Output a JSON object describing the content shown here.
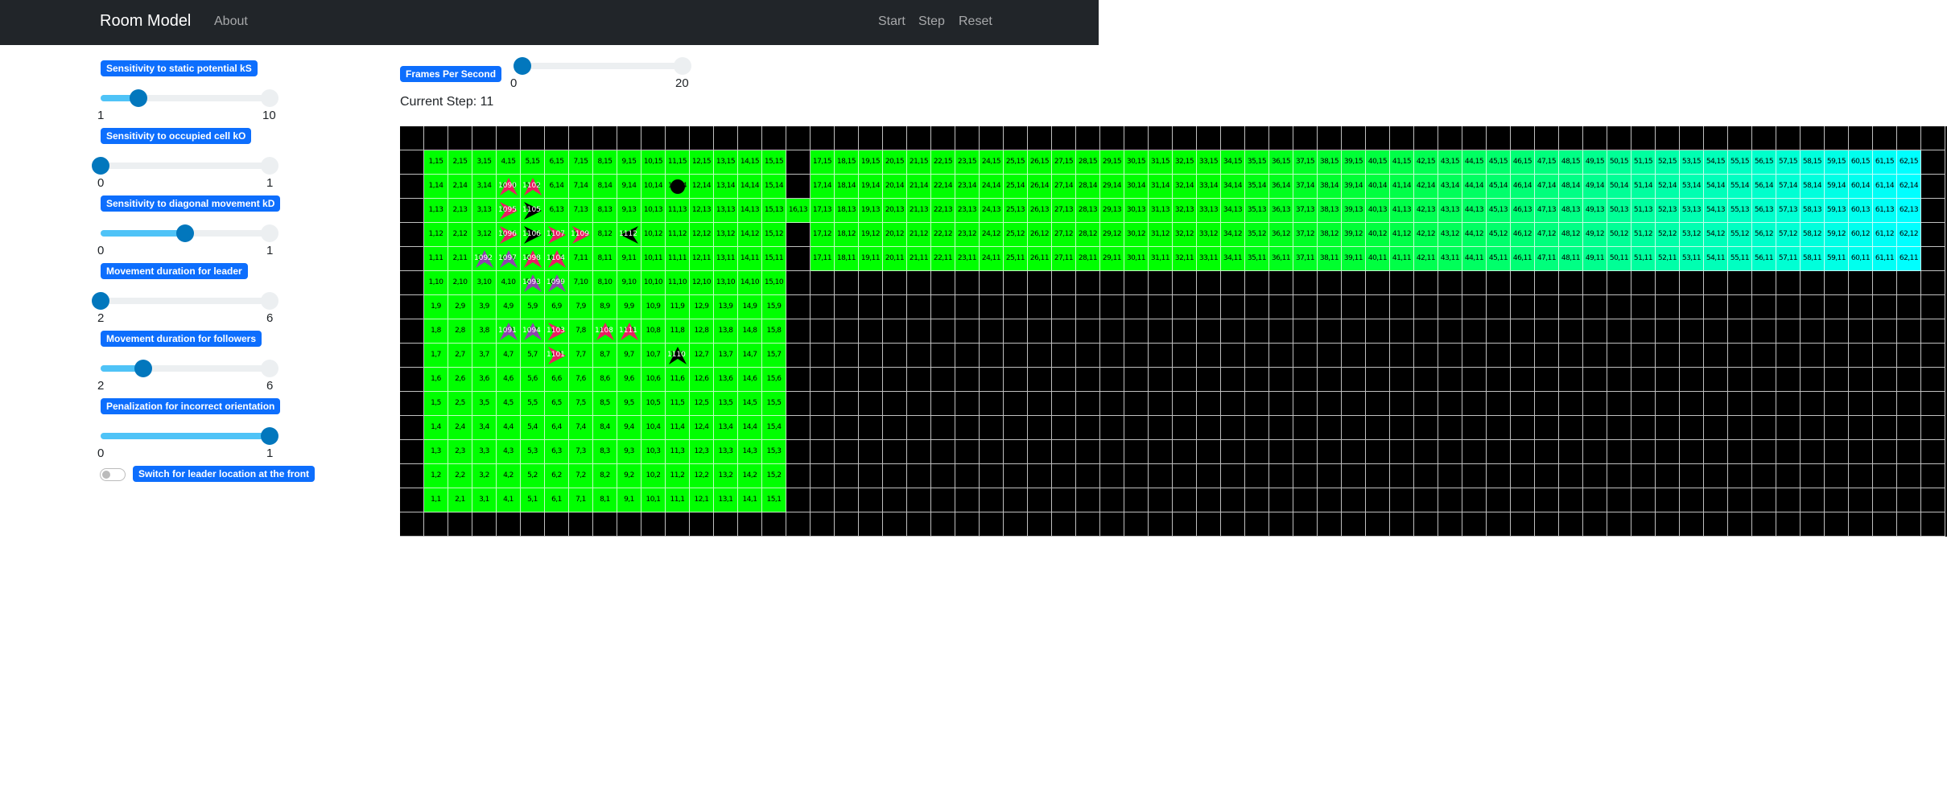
{
  "navbar": {
    "brand": "Room Model",
    "links": {
      "about": "About",
      "start": "Start",
      "step": "Step",
      "reset": "Reset"
    },
    "background": "#212529"
  },
  "controls": {
    "ks": {
      "label": "Sensitivity to static potential kS",
      "min_label": "1",
      "max_label": "10",
      "min": 1,
      "max": 10,
      "value": 3
    },
    "ko": {
      "label": "Sensitivity to occupied cell kO",
      "min_label": "0",
      "max_label": "1",
      "min": 0,
      "max": 1,
      "value": 0
    },
    "kd": {
      "label": "Sensitivity to diagonal movement kD",
      "min_label": "0",
      "max_label": "1",
      "min": 0,
      "max": 1,
      "value": 0.5
    },
    "leader_duration": {
      "label": "Movement duration for leader",
      "min_label": "2",
      "max_label": "6",
      "min": 2,
      "max": 6,
      "value": 2
    },
    "follower_duration": {
      "label": "Movement duration for followers",
      "min_label": "2",
      "max_label": "6",
      "min": 2,
      "max": 6,
      "value": 3
    },
    "orientation_penalty": {
      "label": "Penalization for incorrect orientation",
      "min_label": "0",
      "max_label": "1",
      "min": 0,
      "max": 1,
      "value": 1
    },
    "leader_switch": {
      "label": "Switch for leader location at the front",
      "checked": false
    },
    "fps": {
      "label": "Frames Per Second",
      "min_label": "0",
      "max_label": "20",
      "min": 0,
      "max": 20,
      "value": 1
    },
    "accent": "#0d6efd"
  },
  "status": {
    "current_step_text": "Current Step: 11"
  },
  "grid": {
    "wall_color": "#000000",
    "room_color": "#00ff00",
    "corridor_start_color": "#00ff00",
    "corridor_end_color": "#00ffff",
    "room_x": [
      1,
      15
    ],
    "room_y": [
      1,
      15
    ],
    "door": {
      "x": 16,
      "y": 13
    },
    "corridor_x": [
      17,
      62
    ],
    "corridor_y": [
      11,
      15
    ],
    "agents": [
      {
        "id": "1090",
        "x": 4,
        "y": 14,
        "shape": "arrow-up",
        "color": "#e91e63"
      },
      {
        "id": "1102",
        "x": 5,
        "y": 14,
        "shape": "arrow-up",
        "color": "#e91e63"
      },
      {
        "id": "1095",
        "x": 4,
        "y": 13,
        "shape": "arrow-right",
        "color": "#e91e63"
      },
      {
        "id": "1105",
        "x": 5,
        "y": 13,
        "shape": "arrow-right",
        "color": "#000000"
      },
      {
        "id": "1096",
        "x": 4,
        "y": 12,
        "shape": "arrow-right",
        "color": "#e91e63"
      },
      {
        "id": "1106",
        "x": 5,
        "y": 12,
        "shape": "arrow-right",
        "color": "#000000"
      },
      {
        "id": "1107",
        "x": 6,
        "y": 12,
        "shape": "arrow-right",
        "color": "#e91e63"
      },
      {
        "id": "1109",
        "x": 7,
        "y": 12,
        "shape": "arrow-right",
        "color": "#e91e63"
      },
      {
        "id": "1112",
        "x": 9,
        "y": 12,
        "shape": "arrow-left",
        "color": "#000000"
      },
      {
        "id": "1092",
        "x": 3,
        "y": 11,
        "shape": "arrow-up",
        "color": "#8e44ad"
      },
      {
        "id": "1097",
        "x": 4,
        "y": 11,
        "shape": "arrow-up",
        "color": "#8e44ad"
      },
      {
        "id": "1098",
        "x": 5,
        "y": 11,
        "shape": "arrow-up",
        "color": "#e91e63"
      },
      {
        "id": "1104",
        "x": 6,
        "y": 11,
        "shape": "arrow-up",
        "color": "#e91e63"
      },
      {
        "id": "1093",
        "x": 5,
        "y": 10,
        "shape": "arrow-up",
        "color": "#8e44ad"
      },
      {
        "id": "1099",
        "x": 6,
        "y": 10,
        "shape": "arrow-up",
        "color": "#8e44ad"
      },
      {
        "id": "1091",
        "x": 4,
        "y": 8,
        "shape": "arrow-up",
        "color": "#8e44ad"
      },
      {
        "id": "1094",
        "x": 5,
        "y": 8,
        "shape": "arrow-up",
        "color": "#8e44ad"
      },
      {
        "id": "1103",
        "x": 6,
        "y": 8,
        "shape": "arrow-right",
        "color": "#e91e63"
      },
      {
        "id": "1108",
        "x": 8,
        "y": 8,
        "shape": "arrow-up",
        "color": "#e91e63"
      },
      {
        "id": "1111",
        "x": 9,
        "y": 8,
        "shape": "arrow-up",
        "color": "#e91e63"
      },
      {
        "id": "1101",
        "x": 6,
        "y": 7,
        "shape": "arrow-right",
        "color": "#e91e63"
      },
      {
        "id": "1110",
        "x": 11,
        "y": 7,
        "shape": "arrow-up",
        "color": "#000000"
      },
      {
        "id": "",
        "x": 11,
        "y": 14,
        "shape": "circle",
        "color": "#000000"
      }
    ]
  }
}
